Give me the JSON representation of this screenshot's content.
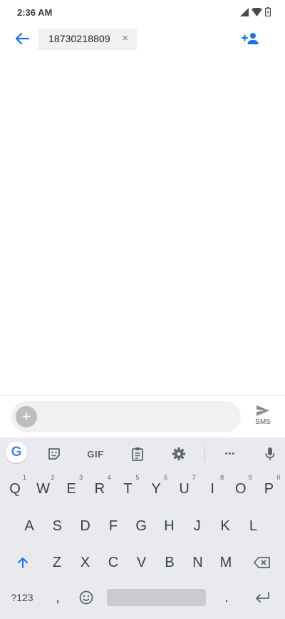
{
  "status_bar": {
    "time": "2:36 AM",
    "icons": [
      "signal-icon",
      "wifi-icon",
      "battery-icon"
    ]
  },
  "app_bar": {
    "back_icon": "arrow-back-icon",
    "recipient_chip": {
      "label": "18730218809",
      "remove_glyph": "×"
    },
    "add_person_icon": "add-person-icon"
  },
  "compose": {
    "attach_glyph": "+",
    "message_value": "",
    "send_label": "SMS"
  },
  "keyboard": {
    "toolbar": {
      "google_logo": "G",
      "gif_label": "GIF",
      "more_glyph": "•••"
    },
    "row1": [
      {
        "label": "Q",
        "hint": "1"
      },
      {
        "label": "W",
        "hint": "2"
      },
      {
        "label": "E",
        "hint": "3"
      },
      {
        "label": "R",
        "hint": "4"
      },
      {
        "label": "T",
        "hint": "5"
      },
      {
        "label": "Y",
        "hint": "6"
      },
      {
        "label": "U",
        "hint": "7"
      },
      {
        "label": "I",
        "hint": "8"
      },
      {
        "label": "O",
        "hint": "9"
      },
      {
        "label": "P",
        "hint": "0"
      }
    ],
    "row2": [
      "A",
      "S",
      "D",
      "F",
      "G",
      "H",
      "J",
      "K",
      "L"
    ],
    "row3": [
      "Z",
      "X",
      "C",
      "V",
      "B",
      "N",
      "M"
    ],
    "row4": {
      "symbols_label": "?123",
      "comma": ",",
      "period": "."
    },
    "colors": {
      "background": "#e8eaed",
      "accent": "#1a73e8"
    }
  }
}
